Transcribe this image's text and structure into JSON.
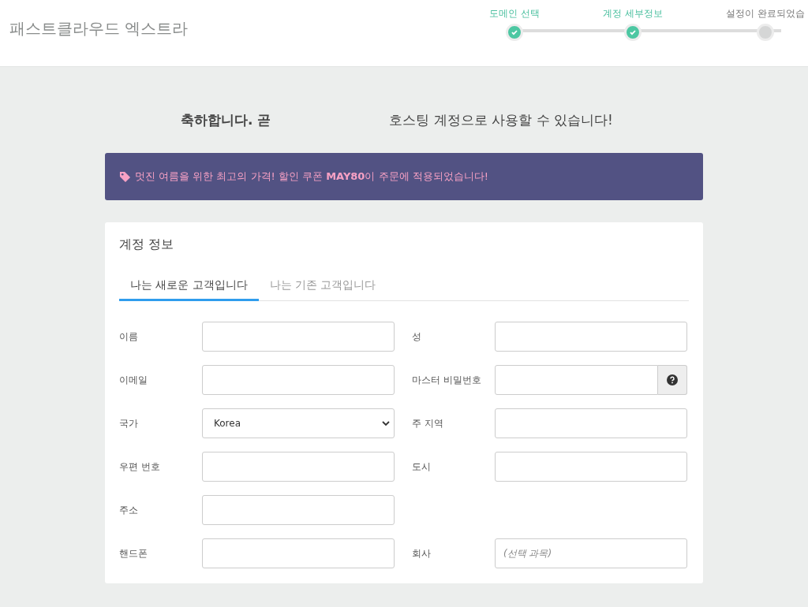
{
  "header": {
    "logo": "패스트클라우드 엑스트라",
    "steps": [
      {
        "label": "도메인 선택",
        "done": true
      },
      {
        "label": "계정 세부정보",
        "done": true
      },
      {
        "label": "설정이 완료되었습",
        "done": false
      }
    ]
  },
  "heading": {
    "lead": "축하합니다. 곧",
    "rest": "호스팅 계정으로 사용할 수 있습니다!"
  },
  "promo": {
    "text": "멋진 여름을 위한 최고의 가격! 할인 쿠폰 **MAY80**이 주문에 적용되었습니다!"
  },
  "card": {
    "title": "계정 정보",
    "tabs": [
      {
        "label": "나는 새로운 고객입니다",
        "selected": true
      },
      {
        "label": "나는 기존 고객입니다",
        "selected": false
      }
    ],
    "rows": [
      [
        {
          "label": "이름",
          "kind": "text"
        },
        {
          "label": "성",
          "kind": "text"
        }
      ],
      [
        {
          "label": "이메일",
          "kind": "text"
        },
        {
          "label": "마스터 비밀번호",
          "kind": "help"
        }
      ],
      [
        {
          "label": "국가",
          "kind": "select",
          "value": "Korea"
        },
        {
          "label": "주 지역",
          "kind": "text"
        }
      ],
      [
        {
          "label": "우편 번호",
          "kind": "text"
        },
        {
          "label": "도시",
          "kind": "text"
        }
      ],
      [
        {
          "label": "주소",
          "kind": "text"
        }
      ],
      [
        {
          "label": "핸드폰",
          "kind": "text"
        },
        {
          "label": "회사",
          "kind": "text",
          "placeholder": "(선택 과목)"
        }
      ]
    ]
  }
}
